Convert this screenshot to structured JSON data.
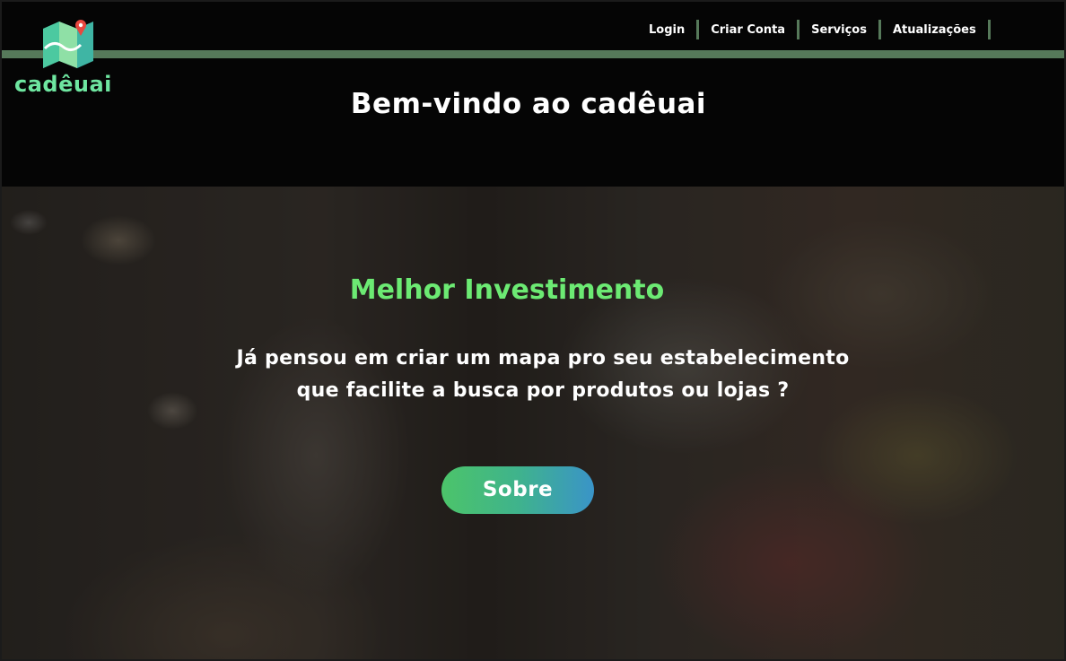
{
  "brand": {
    "name": "cadêuai",
    "logo_icon": "map-pin-icon",
    "colors": {
      "logo_text": "#6ee6a0",
      "accent_bar": "#56795a",
      "hero_title": "#6cea73"
    }
  },
  "nav": {
    "items": [
      {
        "label": "Login"
      },
      {
        "label": "Criar Conta"
      },
      {
        "label": "Serviços"
      },
      {
        "label": "Atualizações"
      }
    ]
  },
  "header": {
    "welcome": "Bem-vindo ao cadêuai"
  },
  "hero": {
    "title": "Melhor Investimento",
    "text_lines": [
      "Já pensou em criar um mapa pro seu estabelecimento",
      "que facilite a busca por produtos ou lojas ?"
    ],
    "button_label": "Sobre"
  }
}
